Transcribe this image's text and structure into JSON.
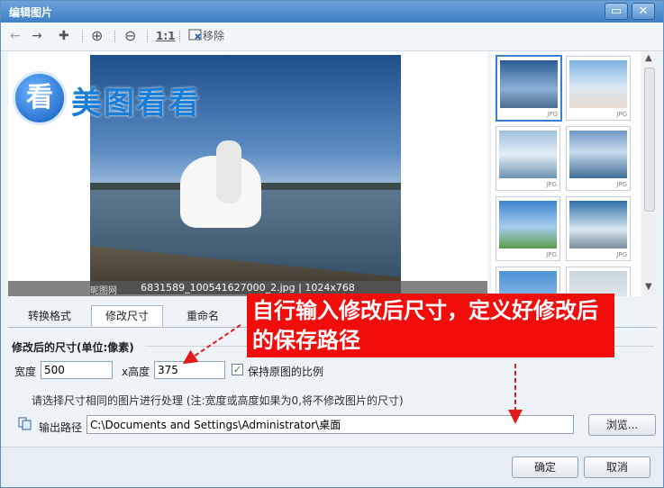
{
  "window": {
    "title": "编辑图片",
    "maximize_glyph": "▭",
    "close_glyph": "✕"
  },
  "toolbar": {
    "back_glyph": "←",
    "forward_glyph": "→",
    "add_glyph": "✚",
    "zoom_in_glyph": "⊕",
    "zoom_out_glyph": "⊖",
    "actual_size_label": "1:1",
    "remove_label": "移除"
  },
  "preview": {
    "caption": "6831589_100541627000_2.jpg | 1024x768",
    "watermark": "昵图网",
    "logo_glyph": "看",
    "logo_text": "美图看看"
  },
  "thumbnails": [
    {
      "label": "JPG"
    },
    {
      "label": "JPG"
    },
    {
      "label": "JPG"
    },
    {
      "label": "JPG"
    },
    {
      "label": "JPG"
    },
    {
      "label": "JPG"
    },
    {
      "label": ""
    },
    {
      "label": ""
    }
  ],
  "tabs": [
    {
      "label": "转换格式"
    },
    {
      "label": "修改尺寸"
    },
    {
      "label": "重命名"
    }
  ],
  "form": {
    "group_title": "修改后的尺寸(单位:像素)",
    "width_label": "宽度",
    "width_value": "500",
    "height_label": "x高度",
    "height_value": "375",
    "keep_ratio_label": "保持原图的比例",
    "keep_ratio_checked": "✓",
    "hint": "请选择尺寸相同的图片进行处理 (注:宽度或高度如果为0,将不修改图片的尺寸)",
    "output_label": "输出路径",
    "output_value": "C:\\Documents and Settings\\Administrator\\桌面",
    "browse_label": "浏览..."
  },
  "footer": {
    "ok_label": "确定",
    "cancel_label": "取消"
  },
  "annotation": {
    "text": "自行输入修改后尺寸，定义好修改后的保存路径"
  },
  "colors": {
    "accent": "#3f7fc4",
    "callout": "#f20d0d",
    "arrow": "#e21b1b"
  }
}
